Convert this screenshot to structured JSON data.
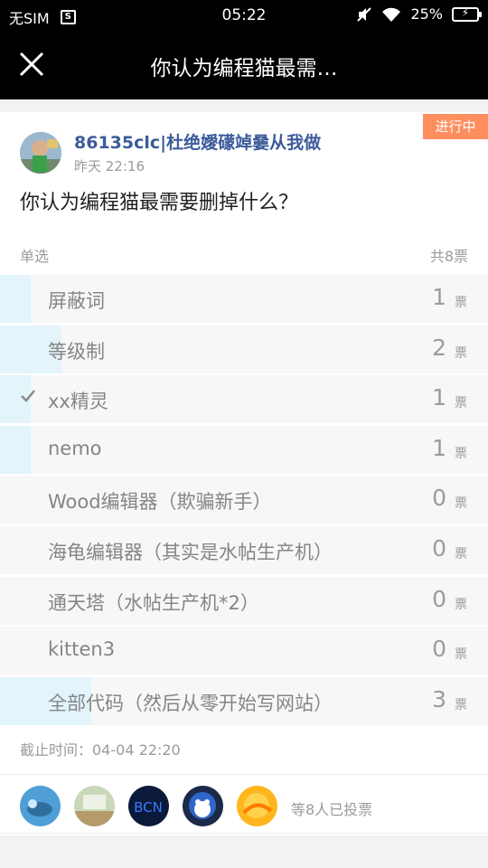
{
  "status_bar": {
    "sim": "无SIM",
    "sim_icon": "S",
    "clock": "05:22",
    "battery": "25%",
    "icons": [
      "sim-card-icon",
      "mute-icon",
      "wifi-icon",
      "battery-charging-icon"
    ]
  },
  "nav": {
    "close_icon": "close-icon",
    "title": "你认为编程猫最需…"
  },
  "poll": {
    "status_badge": "进行中",
    "author": "86135clc|杜绝嬡礞竨嘦从我做",
    "time": "昨天 22:16",
    "question": "你认为编程猫最需要删掉什么？",
    "type": "单选",
    "total": "共8票",
    "unit": "票",
    "total_votes": 8,
    "options": [
      {
        "label": "屏蔽词",
        "count": "1",
        "votes": 1,
        "checked": false
      },
      {
        "label": "等级制",
        "count": "2",
        "votes": 2,
        "checked": false
      },
      {
        "label": "xx精灵",
        "count": "1",
        "votes": 1,
        "checked": true
      },
      {
        "label": "nemo",
        "count": "1",
        "votes": 1,
        "checked": false
      },
      {
        "label": "Wood编辑器（欺骗新手）",
        "count": "0",
        "votes": 0,
        "checked": false
      },
      {
        "label": "海龟编辑器（其实是水帖生产机）",
        "count": "0",
        "votes": 0,
        "checked": false
      },
      {
        "label": "通天塔（水帖生产机*2）",
        "count": "0",
        "votes": 0,
        "checked": false
      },
      {
        "label": "kitten3",
        "count": "0",
        "votes": 0,
        "checked": false
      },
      {
        "label": "全部代码（然后从零开始写网站）",
        "count": "3",
        "votes": 3,
        "checked": false
      }
    ],
    "deadline": "截止时间：04-04 22:20",
    "voters_text": "等8人已投票"
  },
  "colors": {
    "accent_badge": "#ff8e5e",
    "fill": "#e3f4fb",
    "author": "#3b5b9a"
  }
}
